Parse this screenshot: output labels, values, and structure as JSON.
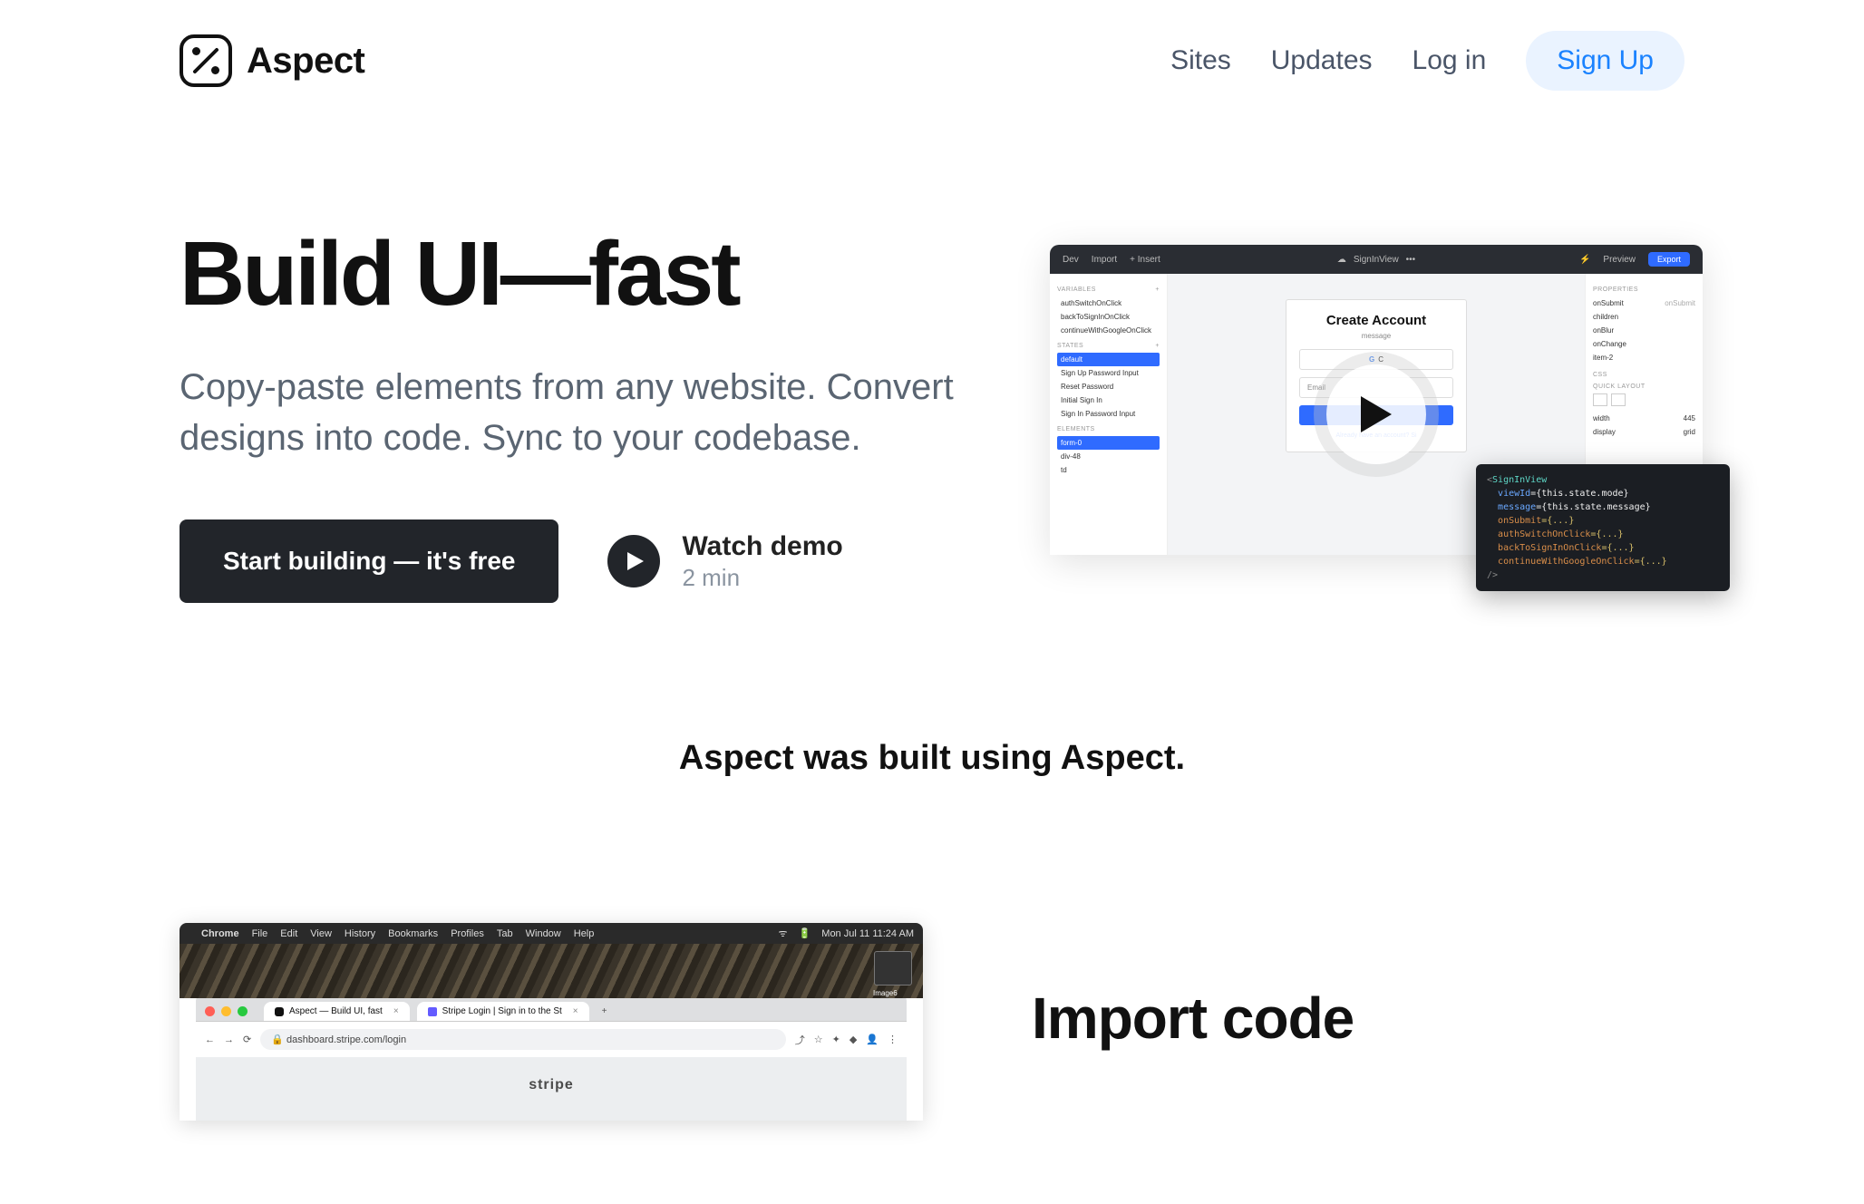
{
  "brand": {
    "name": "Aspect"
  },
  "nav": {
    "sites": "Sites",
    "updates": "Updates",
    "login": "Log in",
    "signup": "Sign Up"
  },
  "hero": {
    "title": "Build UI—fast",
    "subtitle": "Copy-paste elements from any website. Convert designs into code. Sync to your codebase.",
    "primary_cta": "Start building — it's free",
    "watch_demo": "Watch demo",
    "watch_duration": "2 min"
  },
  "editor": {
    "top": {
      "dev": "Dev",
      "import": "Import",
      "insert": "+ Insert",
      "title": "SignInView",
      "more": "•••",
      "preview": "Preview",
      "export": "Export"
    },
    "variables_header": "VARIABLES",
    "variables": [
      "authSwitchOnClick",
      "backToSignInOnClick",
      "continueWithGoogleOnClick"
    ],
    "states_header": "STATES",
    "states": [
      "default",
      "Sign Up Password Input",
      "Reset Password",
      "Initial Sign In",
      "Sign In Password Input"
    ],
    "elements_header": "ELEMENTS",
    "elements": [
      "form-0",
      "div-48",
      "td"
    ],
    "canvas": {
      "heading": "Create Account",
      "message": "message",
      "google": "C",
      "email": "Email",
      "footer_text": "Already have an account? ",
      "footer_link": "Si"
    },
    "right": {
      "properties_header": "PROPERTIES",
      "props": [
        "onSubmit",
        "children",
        "onBlur",
        "onChange",
        "item-2"
      ],
      "css_header": "CSS",
      "quick_header": "QUICK LAYOUT",
      "width_label": "width",
      "width_val": "445",
      "display_label": "display",
      "display_val": "grid"
    },
    "code": {
      "l1a": "<",
      "l1b": "SignInView",
      "l2a": "viewId",
      "l2b": "={this.state.mode}",
      "l3a": "message",
      "l3b": "={this.state.message}",
      "l4a": "onSubmit",
      "l4b": "={...}",
      "l5a": "authSwitchOnClick",
      "l5b": "={...}",
      "l6a": "backToSignInOnClick",
      "l6b": "={...}",
      "l7a": "continueWithGoogleOnClick",
      "l7b": "={...}",
      "l8": "/>"
    }
  },
  "tagline": "Aspect was built using Aspect.",
  "menubar": {
    "items": [
      "Chrome",
      "File",
      "Edit",
      "View",
      "History",
      "Bookmarks",
      "Profiles",
      "Tab",
      "Window",
      "Help"
    ],
    "clock": "Mon Jul 11  11:24 AM"
  },
  "browser": {
    "tab1": "Aspect — Build UI, fast",
    "tab2": "Stripe Login | Sign in to the St",
    "url": "dashboard.stripe.com/login",
    "page_brand": "stripe"
  },
  "import": {
    "title": "Import code"
  }
}
